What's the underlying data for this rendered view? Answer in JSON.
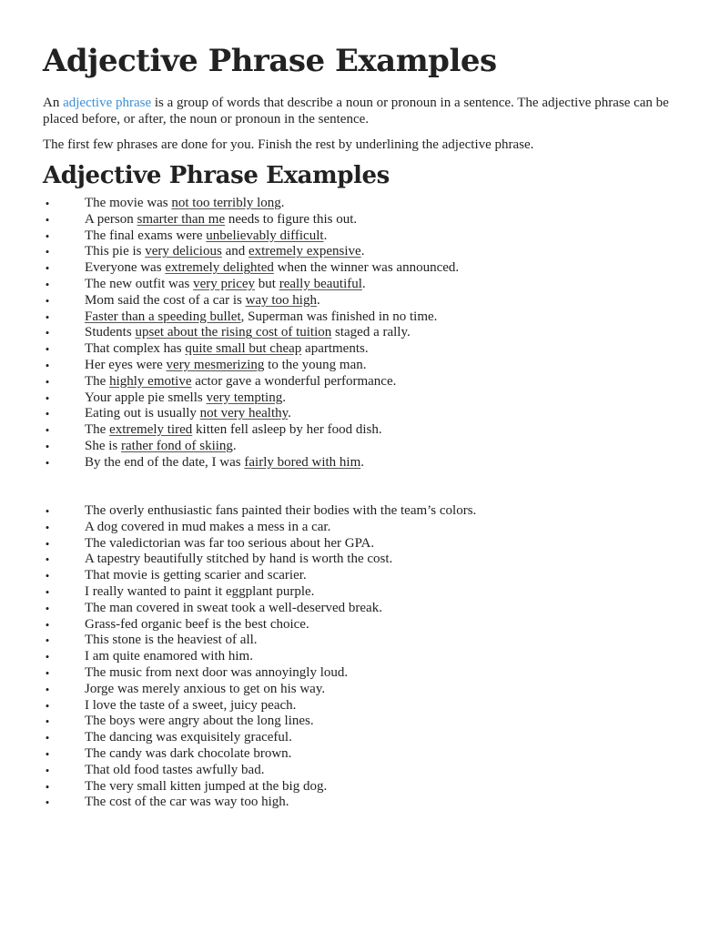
{
  "page": {
    "title": "Adjective Phrase Examples",
    "intro": {
      "prefix": "An ",
      "link_text": "adjective phrase",
      "suffix": " is a group of words that describe a noun or pronoun in a sentence. The adjective phrase can be placed before, or after, the noun or pronoun in the sentence."
    },
    "instructions": "The first few phrases are done for you. Finish the rest by underlining the adjective phrase.",
    "section_title": "Adjective Phrase Examples",
    "bullet_glyph": "•",
    "link_color": "#3a8fd6",
    "completed_examples": [
      [
        {
          "t": "The movie was "
        },
        {
          "t": "not too terribly long",
          "u": true
        },
        {
          "t": "."
        }
      ],
      [
        {
          "t": "A person "
        },
        {
          "t": "smarter than me",
          "u": true
        },
        {
          "t": " needs to figure this out."
        }
      ],
      [
        {
          "t": "The final exams were "
        },
        {
          "t": "unbelievably difficult",
          "u": true
        },
        {
          "t": "."
        }
      ],
      [
        {
          "t": "This pie is "
        },
        {
          "t": "very delicious",
          "u": true
        },
        {
          "t": " and "
        },
        {
          "t": "extremely expensive",
          "u": true
        },
        {
          "t": "."
        }
      ],
      [
        {
          "t": "Everyone was "
        },
        {
          "t": "extremely delighted",
          "u": true
        },
        {
          "t": " when the winner was announced."
        }
      ],
      [
        {
          "t": "The new outfit was "
        },
        {
          "t": "very pricey",
          "u": true
        },
        {
          "t": " but "
        },
        {
          "t": "really beautiful",
          "u": true
        },
        {
          "t": "."
        }
      ],
      [
        {
          "t": "Mom said the cost of a car is "
        },
        {
          "t": "way too high",
          "u": true
        },
        {
          "t": "."
        }
      ],
      [
        {
          "t": "Faster than a speeding bullet",
          "u": true
        },
        {
          "t": ", Superman was finished in no time."
        }
      ],
      [
        {
          "t": "Students "
        },
        {
          "t": "upset about the rising cost of tuition",
          "u": true
        },
        {
          "t": " staged a rally."
        }
      ],
      [
        {
          "t": "That complex has "
        },
        {
          "t": "quite small but cheap",
          "u": true
        },
        {
          "t": " apartments."
        }
      ],
      [
        {
          "t": "Her eyes were "
        },
        {
          "t": "very mesmerizing",
          "u": true
        },
        {
          "t": " to the young man."
        }
      ],
      [
        {
          "t": "The "
        },
        {
          "t": "highly emotive",
          "u": true
        },
        {
          "t": " actor gave a wonderful performance."
        }
      ],
      [
        {
          "t": "Your apple pie smells "
        },
        {
          "t": "very tempting",
          "u": true
        },
        {
          "t": "."
        }
      ],
      [
        {
          "t": "Eating out is usually "
        },
        {
          "t": "not very healthy",
          "u": true
        },
        {
          "t": "."
        }
      ],
      [
        {
          "t": "The "
        },
        {
          "t": "extremely tired",
          "u": true
        },
        {
          "t": " kitten fell asleep by her food dish."
        }
      ],
      [
        {
          "t": "She is "
        },
        {
          "t": "rather fond of skiing",
          "u": true
        },
        {
          "t": "."
        }
      ],
      [
        {
          "t": "By the end of the date, I was "
        },
        {
          "t": "fairly bored with him",
          "u": true
        },
        {
          "t": "."
        }
      ]
    ],
    "practice_examples": [
      "The overly enthusiastic fans painted their bodies with the team’s colors.",
      "A dog covered in mud makes a mess in a car.",
      "The valedictorian was far too serious about her GPA.",
      "A tapestry beautifully stitched by hand is worth the cost.",
      "That movie is getting scarier and scarier.",
      "I really wanted to paint it eggplant purple.",
      "The man covered in sweat took a well-deserved break.",
      "Grass-fed organic beef is the best choice.",
      "This stone is the heaviest of all.",
      "I am quite enamored with him.",
      "The music from next door was annoyingly loud.",
      "Jorge was merely anxious to get on his way.",
      "I love the taste of a sweet, juicy peach.",
      "The boys were angry about the long lines.",
      "The dancing was exquisitely graceful.",
      "The candy was dark chocolate brown.",
      "That old food tastes awfully bad.",
      "The very small kitten jumped at the big dog.",
      "The cost of the car was way too high."
    ]
  }
}
